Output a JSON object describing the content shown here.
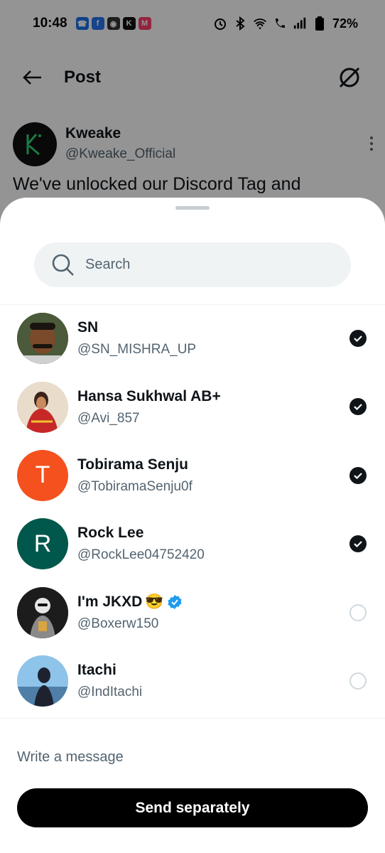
{
  "status_bar": {
    "time": "10:48",
    "battery": "72%",
    "notification_icons": [
      "phone-app-icon",
      "flipkart-icon",
      "whatsapp-business-icon",
      "kweake-icon",
      "myntra-icon"
    ],
    "system_icons": [
      "alarm-icon",
      "bluetooth-icon",
      "wifi-icon",
      "wifi-calling-icon",
      "signal-icon",
      "battery-icon"
    ]
  },
  "header": {
    "title": "Post"
  },
  "post": {
    "author_name": "Kweake",
    "author_handle": "@Kweake_Official",
    "text": "We've unlocked our Discord Tag and"
  },
  "share_sheet": {
    "search_placeholder": "Search",
    "users": [
      {
        "name": "SN",
        "handle": "@SN_MISHRA_UP",
        "selected": true,
        "verified": false,
        "emoji": ""
      },
      {
        "name": "Hansa Sukhwal AB+",
        "handle": "@Avi_857",
        "selected": true,
        "verified": false,
        "emoji": ""
      },
      {
        "name": "Tobirama Senju",
        "handle": "@TobiramaSenju0f",
        "selected": true,
        "verified": false,
        "emoji": "",
        "initial": "T",
        "avatar_color": "#f4511e"
      },
      {
        "name": "Rock Lee",
        "handle": "@RockLee04752420",
        "selected": true,
        "verified": false,
        "emoji": "",
        "initial": "R",
        "avatar_color": "#00574b"
      },
      {
        "name": "I'm JKXD",
        "handle": "@Boxerw150",
        "selected": false,
        "verified": true,
        "emoji": "😎"
      },
      {
        "name": "Itachi",
        "handle": "@IndItachi",
        "selected": false,
        "verified": false,
        "emoji": ""
      }
    ],
    "message_placeholder": "Write a message",
    "send_label": "Send separately"
  },
  "colors": {
    "accent_black": "#0f1419",
    "secondary_text": "#536471",
    "verified_blue": "#1d9bf0",
    "search_bg": "#eff3f4"
  }
}
